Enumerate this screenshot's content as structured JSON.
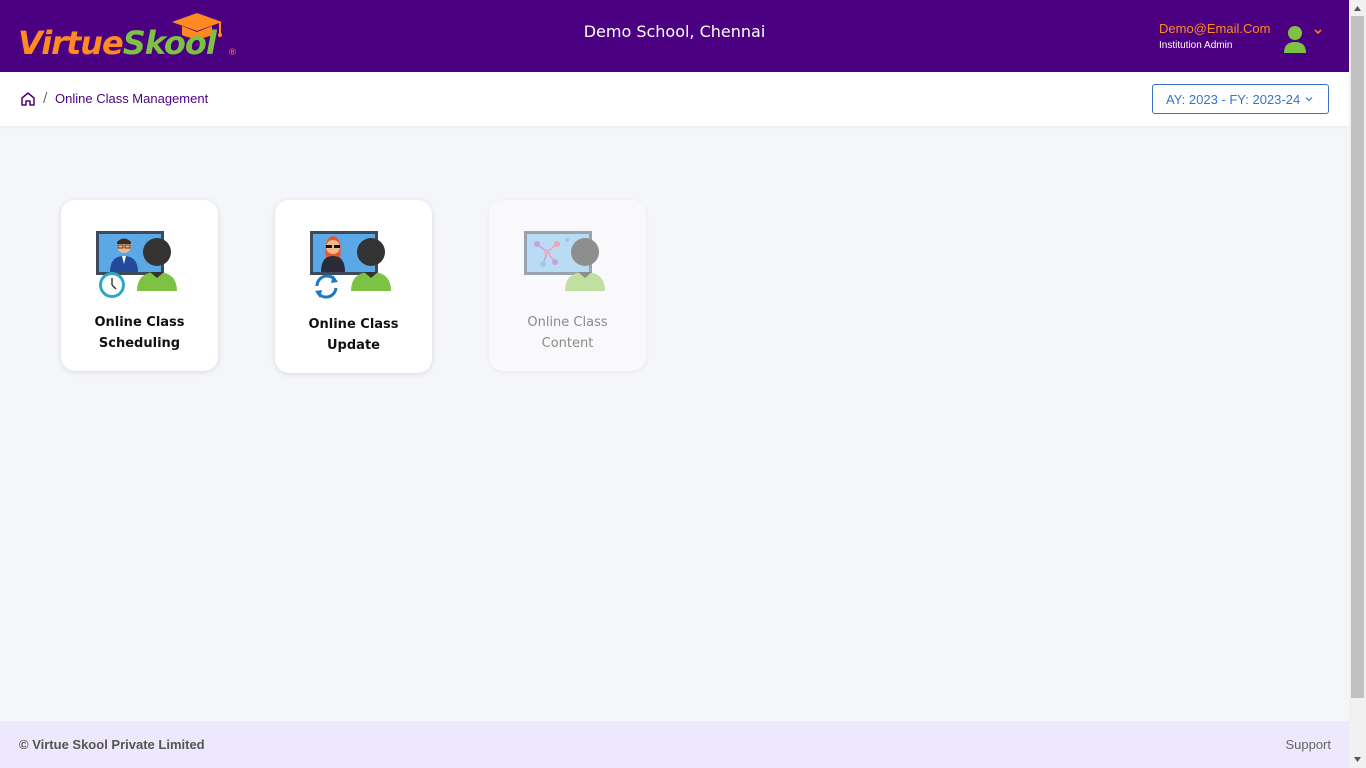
{
  "header": {
    "logo_part1": "Virtue",
    "logo_part2": "Skool",
    "logo_reg": "®",
    "school_name": "Demo School, Chennai",
    "user_email": "Demo@Email.Com",
    "user_role": "Institution Admin",
    "icons": {
      "avatar": "user-avatar-icon",
      "menu": "chevron-down-icon"
    }
  },
  "breadcrumb": {
    "home_icon": "home-icon",
    "separator": "/",
    "current": "Online Class Management"
  },
  "year_selector": {
    "label": "AY: 2023 - FY: 2023-24"
  },
  "cards": [
    {
      "label": "Online Class Scheduling",
      "icon": "online-class-scheduling-icon",
      "enabled": true
    },
    {
      "label": "Online Class Update",
      "icon": "online-class-update-icon",
      "enabled": true
    },
    {
      "label": "Online Class Content",
      "icon": "online-class-content-icon",
      "enabled": false
    }
  ],
  "footer": {
    "copyright": "© Virtue Skool Private Limited",
    "support": "Support"
  },
  "colors": {
    "header_bg": "#4b0082",
    "accent_orange": "#ff8a1f",
    "accent_green": "#7dc242",
    "link_blue": "#3b73c8",
    "footer_bg": "#ede8fb",
    "page_bg": "#f5f6fa"
  }
}
